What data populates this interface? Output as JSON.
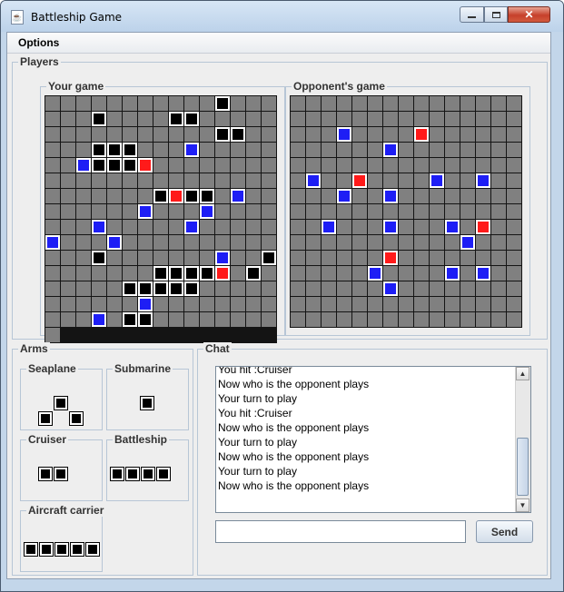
{
  "window": {
    "title": "Battleship Game",
    "close_glyph": "✕"
  },
  "menu": {
    "options_label": "Options"
  },
  "players": {
    "title": "Players",
    "your_game": {
      "title": "Your game",
      "rows": [
        "...........B...",
        "...B....BB.....",
        "...........BB..",
        "...BBB...U.....",
        "..UBBBR........",
        "................",
        "......BRBB.U...",
        ".....U...U.....",
        "..U.....U.....U",
        "...U...........",
        "..B.......U..B.",
        "......BBBBR.B..",
        "....BBBBB......",
        ".....U.........",
        "..U.BB........."
      ]
    },
    "opponent_game": {
      "title": "Opponent's game",
      "rows": [
        "...............",
        "...............",
        "...U....R......",
        "......U........",
        "...............",
        ".U..R....U..U..",
        "...U..U........",
        "...............",
        "..U...U...U.R..",
        "...........U...",
        "......R........",
        ".....U....U.U..",
        "......U........",
        "...............",
        "..............."
      ]
    }
  },
  "arms": {
    "title": "Arms",
    "items": [
      {
        "label": "Seaplane"
      },
      {
        "label": "Submarine"
      },
      {
        "label": "Cruiser"
      },
      {
        "label": "Battleship"
      },
      {
        "label": "Aircraft carrier"
      }
    ]
  },
  "chat": {
    "title": "Chat",
    "lines": [
      "You hit :Cruiser",
      "Now who is the opponent plays",
      "Your turn to play",
      "You hit :Cruiser",
      "Now who is the opponent plays",
      "Your turn to play",
      "Now who is the opponent plays",
      "Your turn to play",
      "Now who is the opponent plays"
    ],
    "input_value": "",
    "send_label": "Send",
    "scroll_up_glyph": "▲",
    "scroll_down_glyph": "▼"
  },
  "colors": {
    "water": "#808080",
    "ship": "#000000",
    "miss": "#1e1ef5",
    "hit": "#ff1a1a"
  },
  "icons": {
    "app": "java-cup-icon",
    "minimize": "minimize-icon",
    "maximize": "maximize-icon",
    "close": "close-icon"
  }
}
